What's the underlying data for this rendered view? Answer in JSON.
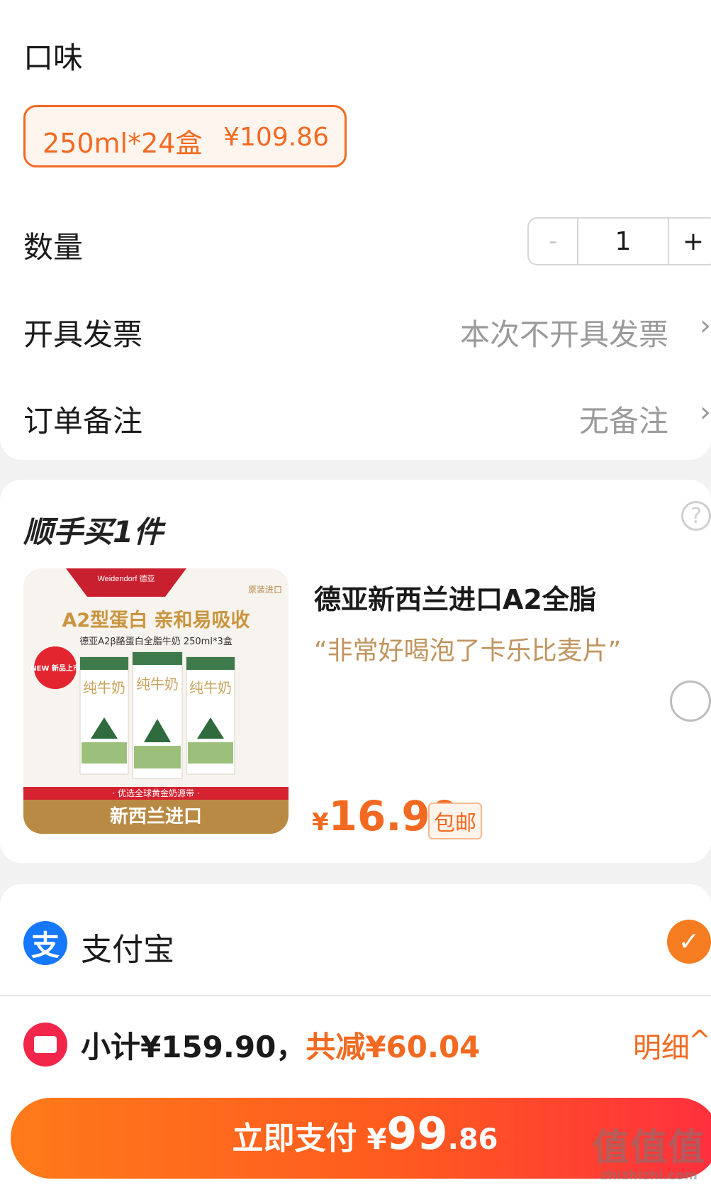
{
  "options": {
    "flavor_label": "口味",
    "flavor_chip": {
      "name": "250ml*24盒",
      "price": "¥109.86"
    },
    "quantity_label": "数量",
    "quantity": {
      "minus": "-",
      "value": "1",
      "plus": "+"
    },
    "invoice_label": "开具发票",
    "invoice_value": "本次不开具发票",
    "note_label": "订单备注",
    "note_value": "无备注",
    "chevron": "›"
  },
  "addon": {
    "title": "顺手买1件",
    "help": "?",
    "product": {
      "title": "德亚新西兰进口A2全脂",
      "quote": "“非常好喝泡了卡乐比麦片”",
      "price_currency": "¥",
      "price": "16.90",
      "badge": "包邮",
      "image": {
        "brand": "Weidendorf 德亚",
        "origin_tag": "原装进口",
        "headline": "A2型蛋白 亲和易吸收",
        "subline": "德亚A2β酪蛋白全脂牛奶 250ml*3盒",
        "new_badge": "NEW 新品上市",
        "carton_text": "纯牛奶",
        "banner_top": "· 优选全球黄金奶源带 ·",
        "banner_main": "新西兰进口"
      }
    }
  },
  "payment": {
    "alipay_icon": "支",
    "alipay_label": "支付宝",
    "check": "✓",
    "subtotal_text": "小计¥159.90，",
    "discount_text": "共减¥60.04",
    "detail_label": "明细",
    "detail_chevron": "^",
    "pay_button": {
      "label": "立即支付",
      "currency": "¥",
      "amount_big": "99",
      "amount_small": ".86"
    }
  },
  "watermark": {
    "line1": "值值值",
    "line2": "zhizhizhi.com"
  },
  "colors": {
    "accent": "#f26a21",
    "alipay": "#1677ff",
    "coupon": "#f2264b"
  }
}
